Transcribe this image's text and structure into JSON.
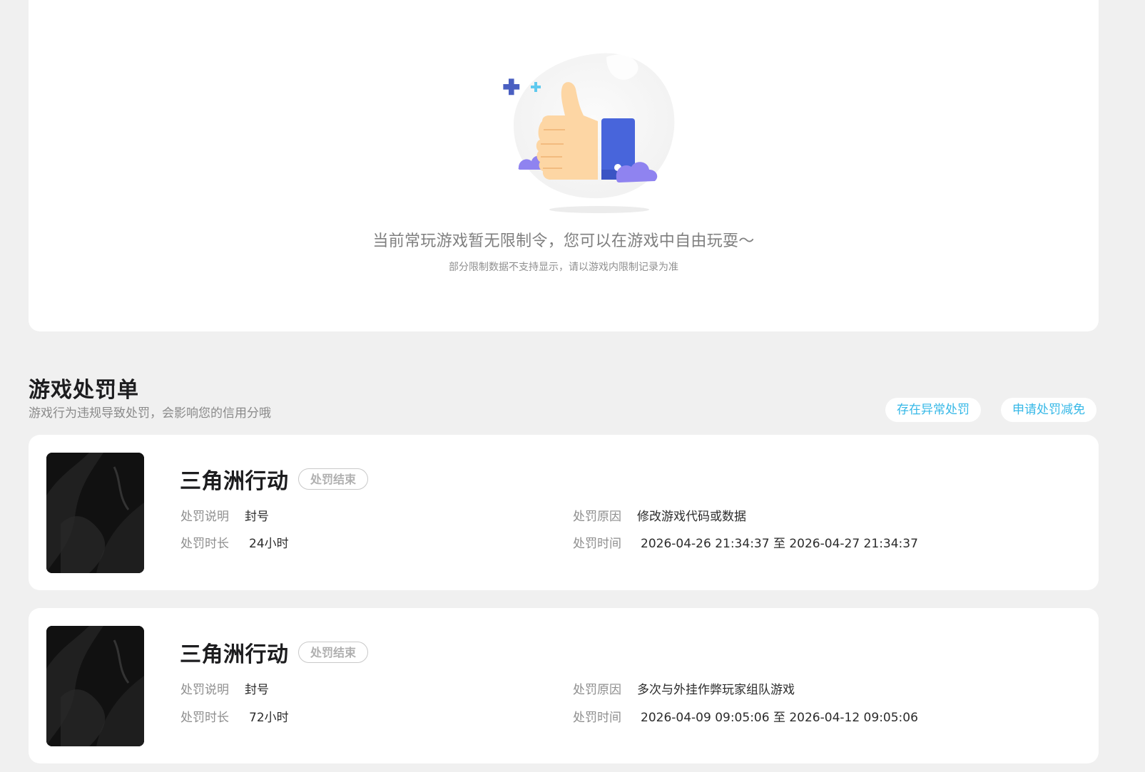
{
  "empty_state": {
    "title": "当前常玩游戏暂无限制令，您可以在游戏中自由玩耍～",
    "subtitle": "部分限制数据不支持显示，请以游戏内限制记录为准"
  },
  "punishment_section": {
    "title": "游戏处罚单",
    "subtitle": "游戏行为违规导致处罚，会影响您的信用分哦",
    "buttons": {
      "abnormal": "存在异常处罚",
      "reduce": "申请处罚减免"
    },
    "labels": {
      "description": "处罚说明",
      "reason": "处罚原因",
      "duration": "处罚时长",
      "time": "处罚时间"
    },
    "records": [
      {
        "game": "三角洲行动",
        "status": "处罚结束",
        "description": "封号",
        "reason": "修改游戏代码或数据",
        "duration": "24小时",
        "time": "2026-04-26 21:34:37 至 2026-04-27 21:34:37"
      },
      {
        "game": "三角洲行动",
        "status": "处罚结束",
        "description": "封号",
        "reason": "多次与外挂作弊玩家组队游戏",
        "duration": "72小时",
        "time": "2026-04-09 09:05:06 至 2026-04-12 09:05:06"
      }
    ]
  },
  "colors": {
    "background": "#f0f0f0",
    "card": "#ffffff",
    "accent": "#36b8e7",
    "muted_text": "#8e8e8e"
  }
}
